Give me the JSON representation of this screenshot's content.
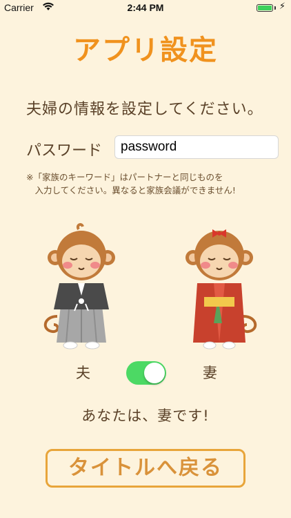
{
  "status_bar": {
    "carrier": "Carrier",
    "time": "2:44 PM",
    "battery_level": 1.0,
    "battery_color": "#3ed15b"
  },
  "title": "アプリ設定",
  "instruction": "夫婦の情報を設定してください。",
  "password": {
    "label": "パスワード",
    "value": "password"
  },
  "note": "※「家族のキーワード」はパートナーと同じものを\n　入力してください。異なると家族会議ができません!",
  "role": {
    "husband_label": "夫",
    "wife_label": "妻",
    "toggle_on": true,
    "toggle_color": "#4cd964",
    "status_text": "あなたは、妻です!"
  },
  "back_button_label": "タイトルへ戻る",
  "colors": {
    "background": "#fdf3dd",
    "title": "#f0921e",
    "text": "#5a4128",
    "button_border": "#e8a53a"
  }
}
